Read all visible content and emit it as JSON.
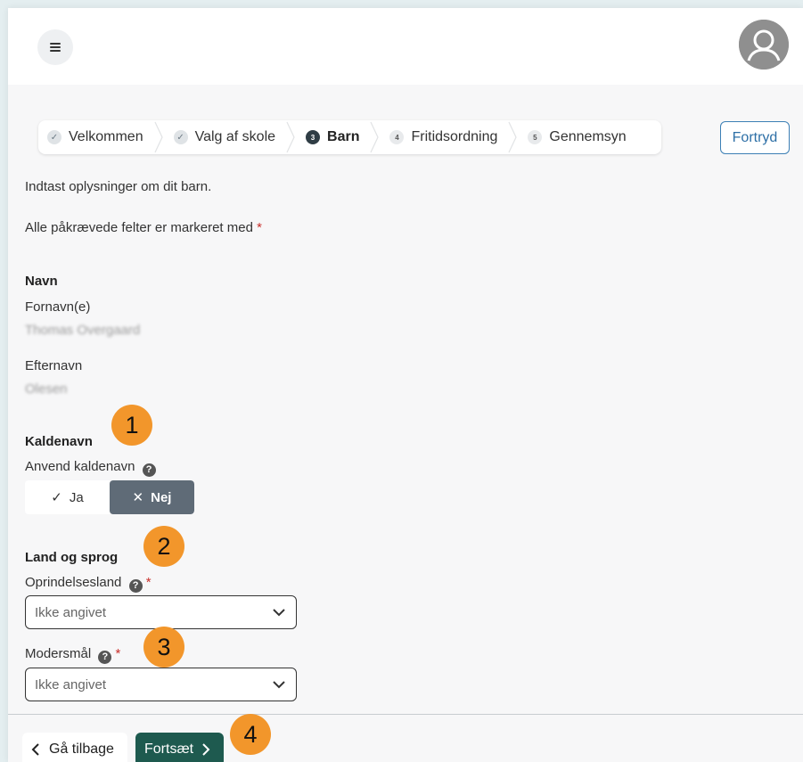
{
  "header": {
    "menu_icon": "hamburger-icon",
    "avatar_icon": "user-avatar-icon"
  },
  "stepper": {
    "steps": [
      {
        "label": "Velkommen",
        "marker": "✓",
        "state": "done"
      },
      {
        "label": "Valg af skole",
        "marker": "✓",
        "state": "done"
      },
      {
        "label": "Barn",
        "marker": "3",
        "state": "active"
      },
      {
        "label": "Fritidsordning",
        "marker": "4",
        "state": "todo"
      },
      {
        "label": "Gennemsyn",
        "marker": "5",
        "state": "todo"
      }
    ]
  },
  "actions": {
    "cancel_label": "Fortryd",
    "back_label": "Gå tilbage",
    "next_label": "Fortsæt"
  },
  "intro": {
    "line1": "Indtast oplysninger om dit barn.",
    "line2": "Alle påkrævede felter er markeret med",
    "required_mark": "*"
  },
  "name_section": {
    "heading": "Navn",
    "first_label": "Fornavn(e)",
    "first_value": "Thomas Overgaard",
    "last_label": "Efternavn",
    "last_value": "Olesen"
  },
  "nickname_section": {
    "heading": "Kaldenavn",
    "use_label": "Anvend kaldenavn",
    "yes_label": "Ja",
    "no_label": "Nej",
    "selected": "Nej"
  },
  "country_section": {
    "heading": "Land og sprog",
    "country_label": "Oprindelsesland",
    "country_value": "Ikke angivet",
    "language_label": "Modersmål",
    "language_value": "Ikke angivet"
  },
  "annotations": [
    "1",
    "2",
    "3",
    "4"
  ],
  "colors": {
    "accent_green": "#1e5a4f",
    "cancel_blue": "#3c7fb5",
    "badge_orange": "#f2962b",
    "required_red": "#c9302c"
  }
}
